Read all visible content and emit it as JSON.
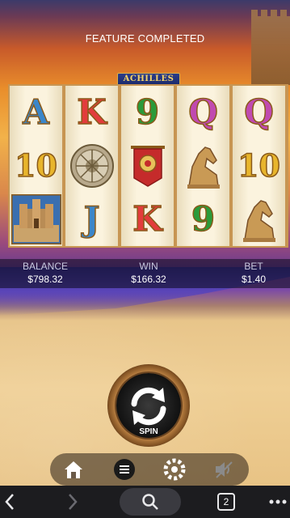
{
  "game": {
    "message": "FEATURE COMPLETED",
    "logo_text": "ACHILLES"
  },
  "reels": [
    [
      "A",
      "10",
      "castle"
    ],
    [
      "K",
      "shield",
      "J"
    ],
    [
      "9",
      "banner",
      "K"
    ],
    [
      "Q",
      "horse",
      "9"
    ],
    [
      "Q",
      "10",
      "horse"
    ]
  ],
  "stats": {
    "balance_label": "BALANCE",
    "balance_value": "$798.32",
    "win_label": "WIN",
    "win_value": "$166.32",
    "bet_label": "BET",
    "bet_value": "$1.40"
  },
  "spin": {
    "label": "SPIN",
    "icon": "spin-arrows-icon"
  },
  "toolbar": {
    "items": [
      "home-icon",
      "menu-icon",
      "settings-icon",
      "sound-muted-icon"
    ]
  },
  "browser": {
    "tab_count": "2",
    "items": [
      "back-icon",
      "forward-icon",
      "search-icon",
      "tabs-icon",
      "more-icon"
    ]
  },
  "colors": {
    "reel_frame": "#c79552",
    "reel_bg": "#fbf3de",
    "spin_ring": "#c78b49",
    "browser_bar": "#1c1c1f"
  }
}
